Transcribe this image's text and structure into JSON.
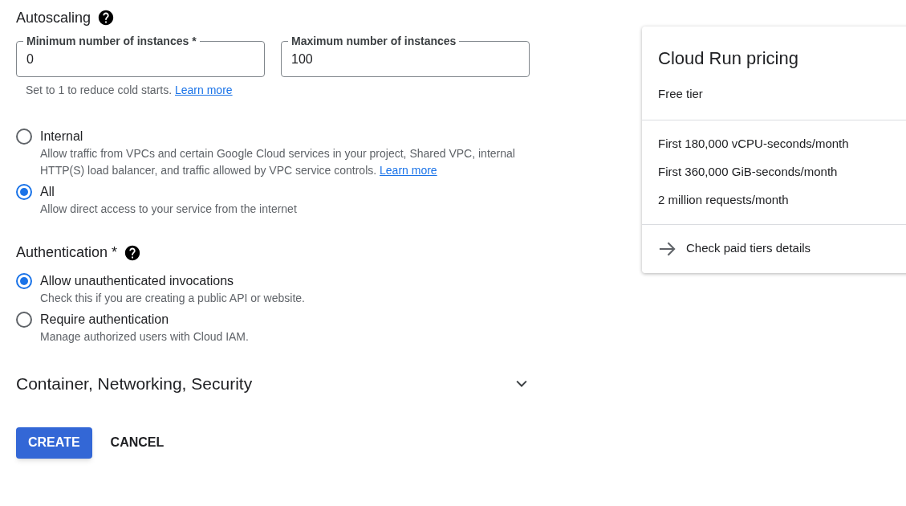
{
  "autoscaling": {
    "title": "Autoscaling",
    "fields": [
      {
        "label": "Minimum number of instances *",
        "value": "0"
      },
      {
        "label": "Maximum number of instances",
        "value": "100"
      }
    ],
    "hint": {
      "text": "Set to 1 to reduce cold starts.",
      "link": "Learn more"
    }
  },
  "ingress": {
    "options": [
      {
        "label": "Internal",
        "description": "Allow traffic from VPCs and certain Google Cloud services in your project, Shared VPC, internal HTTP(S) load balancer, and traffic allowed by VPC service controls.",
        "link": "Learn more",
        "selected": false
      },
      {
        "label": "All",
        "description": "Allow direct access to your service from the internet",
        "selected": true
      }
    ]
  },
  "authentication": {
    "title": "Authentication *",
    "options": [
      {
        "label": "Allow unauthenticated invocations",
        "description": "Check this if you are creating a public API or website.",
        "selected": true
      },
      {
        "label": "Require authentication",
        "description": "Manage authorized users with Cloud IAM.",
        "selected": false
      }
    ]
  },
  "advanced": {
    "title": "Container, Networking, Security",
    "expanded": false
  },
  "buttons": [
    {
      "label": "CREATE",
      "kind": "primary"
    },
    {
      "label": "CANCEL",
      "kind": "text"
    }
  ],
  "pricing": {
    "title": "Cloud Run pricing",
    "subtitle": "Free tier",
    "items": [
      "First 180,000 vCPU-seconds/month",
      "First 360,000 GiB-seconds/month",
      "2 million requests/month"
    ],
    "link": "Check paid tiers details"
  }
}
